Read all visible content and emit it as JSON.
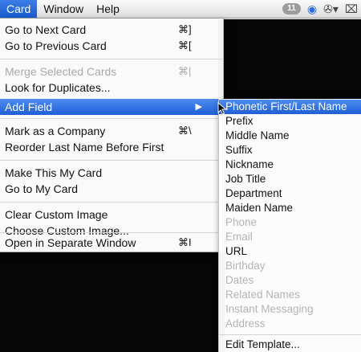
{
  "menubar": {
    "items": [
      "Card",
      "Window",
      "Help"
    ],
    "active_index": 0,
    "badge_count": "11",
    "status_icons": [
      "clock-icon",
      "activity-icon",
      "bluetooth-icon",
      "display-icon"
    ]
  },
  "card_menu": {
    "items": [
      {
        "label": "Go to Next Card",
        "shortcut": "⌘]",
        "enabled": true
      },
      {
        "label": "Go to Previous Card",
        "shortcut": "⌘[",
        "enabled": true
      },
      {
        "label": "Merge Selected Cards",
        "shortcut": "⌘|",
        "enabled": false
      },
      {
        "label": "Look for Duplicates...",
        "shortcut": "",
        "enabled": true
      },
      {
        "label": "Add Field",
        "shortcut": "",
        "enabled": true,
        "has_submenu": true,
        "highlighted": true
      },
      {
        "label": "Mark as a Company",
        "shortcut": "⌘\\",
        "enabled": true
      },
      {
        "label": "Reorder Last Name Before First",
        "shortcut": "",
        "enabled": true
      },
      {
        "label": "Make This My Card",
        "shortcut": "",
        "enabled": true
      },
      {
        "label": "Go to My Card",
        "shortcut": "",
        "enabled": true
      },
      {
        "label": "Clear Custom Image",
        "shortcut": "",
        "enabled": true
      },
      {
        "label": "Choose Custom Image...",
        "shortcut": "",
        "enabled": true
      },
      {
        "label": "Open in Separate Window",
        "shortcut": "⌘I",
        "enabled": true
      }
    ]
  },
  "add_field_submenu": {
    "items": [
      {
        "label": "Phonetic First/Last Name",
        "enabled": true,
        "highlighted": true
      },
      {
        "label": "Prefix",
        "enabled": true
      },
      {
        "label": "Middle Name",
        "enabled": true
      },
      {
        "label": "Suffix",
        "enabled": true
      },
      {
        "label": "Nickname",
        "enabled": true
      },
      {
        "label": "Job Title",
        "enabled": true
      },
      {
        "label": "Department",
        "enabled": true
      },
      {
        "label": "Maiden Name",
        "enabled": true
      },
      {
        "label": "Phone",
        "enabled": false
      },
      {
        "label": "Email",
        "enabled": false
      },
      {
        "label": "URL",
        "enabled": true
      },
      {
        "label": "Birthday",
        "enabled": false
      },
      {
        "label": "Dates",
        "enabled": false
      },
      {
        "label": "Related Names",
        "enabled": false
      },
      {
        "label": "Instant Messaging",
        "enabled": false
      },
      {
        "label": "Address",
        "enabled": false
      },
      {
        "label": "Edit Template...",
        "enabled": true
      }
    ]
  },
  "colors": {
    "highlight": "#2a6be0",
    "disabled_text": "#a9a9a9"
  }
}
